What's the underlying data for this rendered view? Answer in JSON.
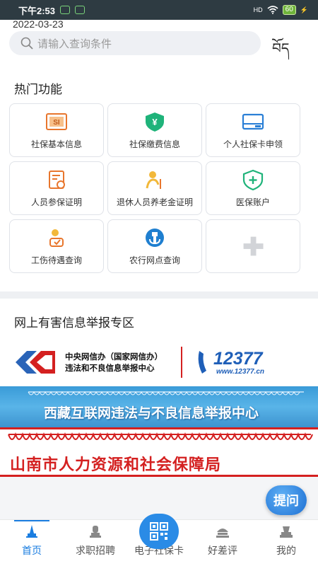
{
  "status_bar": {
    "time": "下午2:53",
    "signal": "HD",
    "battery": "60"
  },
  "header": {
    "date": "2022-03-23",
    "search_placeholder": "请输入查询条件",
    "lang_toggle": "བོད"
  },
  "hot_functions": {
    "title": "热门功能",
    "items": [
      {
        "label": "社保基本信息",
        "icon": "si-card-icon"
      },
      {
        "label": "社保缴费信息",
        "icon": "yuan-shield-icon"
      },
      {
        "label": "个人社保卡申领",
        "icon": "card-icon"
      },
      {
        "label": "人员参保证明",
        "icon": "certificate-icon"
      },
      {
        "label": "退休人员养老金证明",
        "icon": "elder-icon"
      },
      {
        "label": "医保账户",
        "icon": "medical-shield-icon"
      },
      {
        "label": "工伤待遇查询",
        "icon": "injury-icon"
      },
      {
        "label": "农行网点查询",
        "icon": "abc-bank-icon"
      },
      {
        "label": "",
        "icon": "add-icon"
      }
    ]
  },
  "report_zone": {
    "title": "网上有害信息举报专区",
    "banner1": {
      "line1": "中央网信办（国家网信办）",
      "line2": "违法和不良信息举报中心",
      "hotline": "12377",
      "site": "www.12377.cn"
    },
    "banner2": {
      "text": "西藏互联网违法与不良信息举报中心"
    },
    "banner3": {
      "text": "山南市人力资源和社会保障局"
    }
  },
  "fab_label": "提问",
  "tabbar": {
    "tabs": [
      {
        "label": "首页",
        "icon": "home-icon"
      },
      {
        "label": "求职招聘",
        "icon": "jobs-icon"
      },
      {
        "label": "电子社保卡",
        "icon": "qr-icon"
      },
      {
        "label": "好差评",
        "icon": "review-icon"
      },
      {
        "label": "我的",
        "icon": "profile-icon"
      }
    ]
  },
  "colors": {
    "accent": "#1a7de0",
    "icon_orange": "#e8762d",
    "icon_green": "#1fb37a",
    "icon_blue": "#2a7fd6",
    "red": "#d42020"
  }
}
